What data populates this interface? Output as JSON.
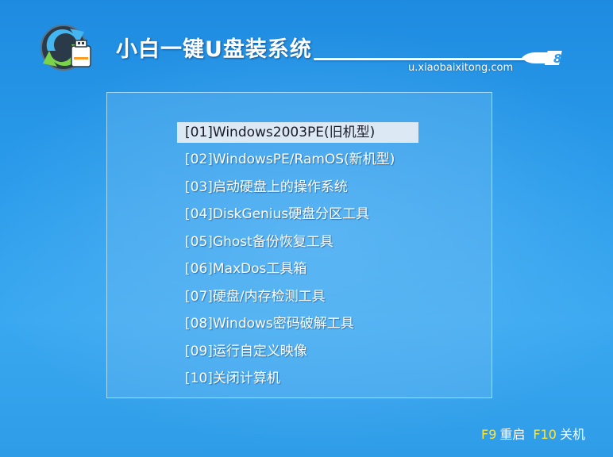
{
  "header": {
    "title": "小白一键U盘装系统",
    "url": "u.xiaobaixitong.com",
    "usb_mark": "8"
  },
  "menu": {
    "items": [
      {
        "label": "[01]Windows2003PE(旧机型)",
        "selected": true
      },
      {
        "label": "[02]WindowsPE/RamOS(新机型)",
        "selected": false
      },
      {
        "label": "[03]启动硬盘上的操作系统",
        "selected": false
      },
      {
        "label": "[04]DiskGenius硬盘分区工具",
        "selected": false
      },
      {
        "label": "[05]Ghost备份恢复工具",
        "selected": false
      },
      {
        "label": "[06]MaxDos工具箱",
        "selected": false
      },
      {
        "label": "[07]硬盘/内存检测工具",
        "selected": false
      },
      {
        "label": "[08]Windows密码破解工具",
        "selected": false
      },
      {
        "label": "[09]运行自定义映像",
        "selected": false
      },
      {
        "label": "[10]关闭计算机",
        "selected": false
      }
    ]
  },
  "footer": {
    "reboot_key": "F9",
    "reboot_label": "重启",
    "shutdown_key": "F10",
    "shutdown_label": "关机"
  },
  "colors": {
    "background": "#2a9bea",
    "highlight": "#dce9f5",
    "hotkey": "#ffe43a"
  }
}
